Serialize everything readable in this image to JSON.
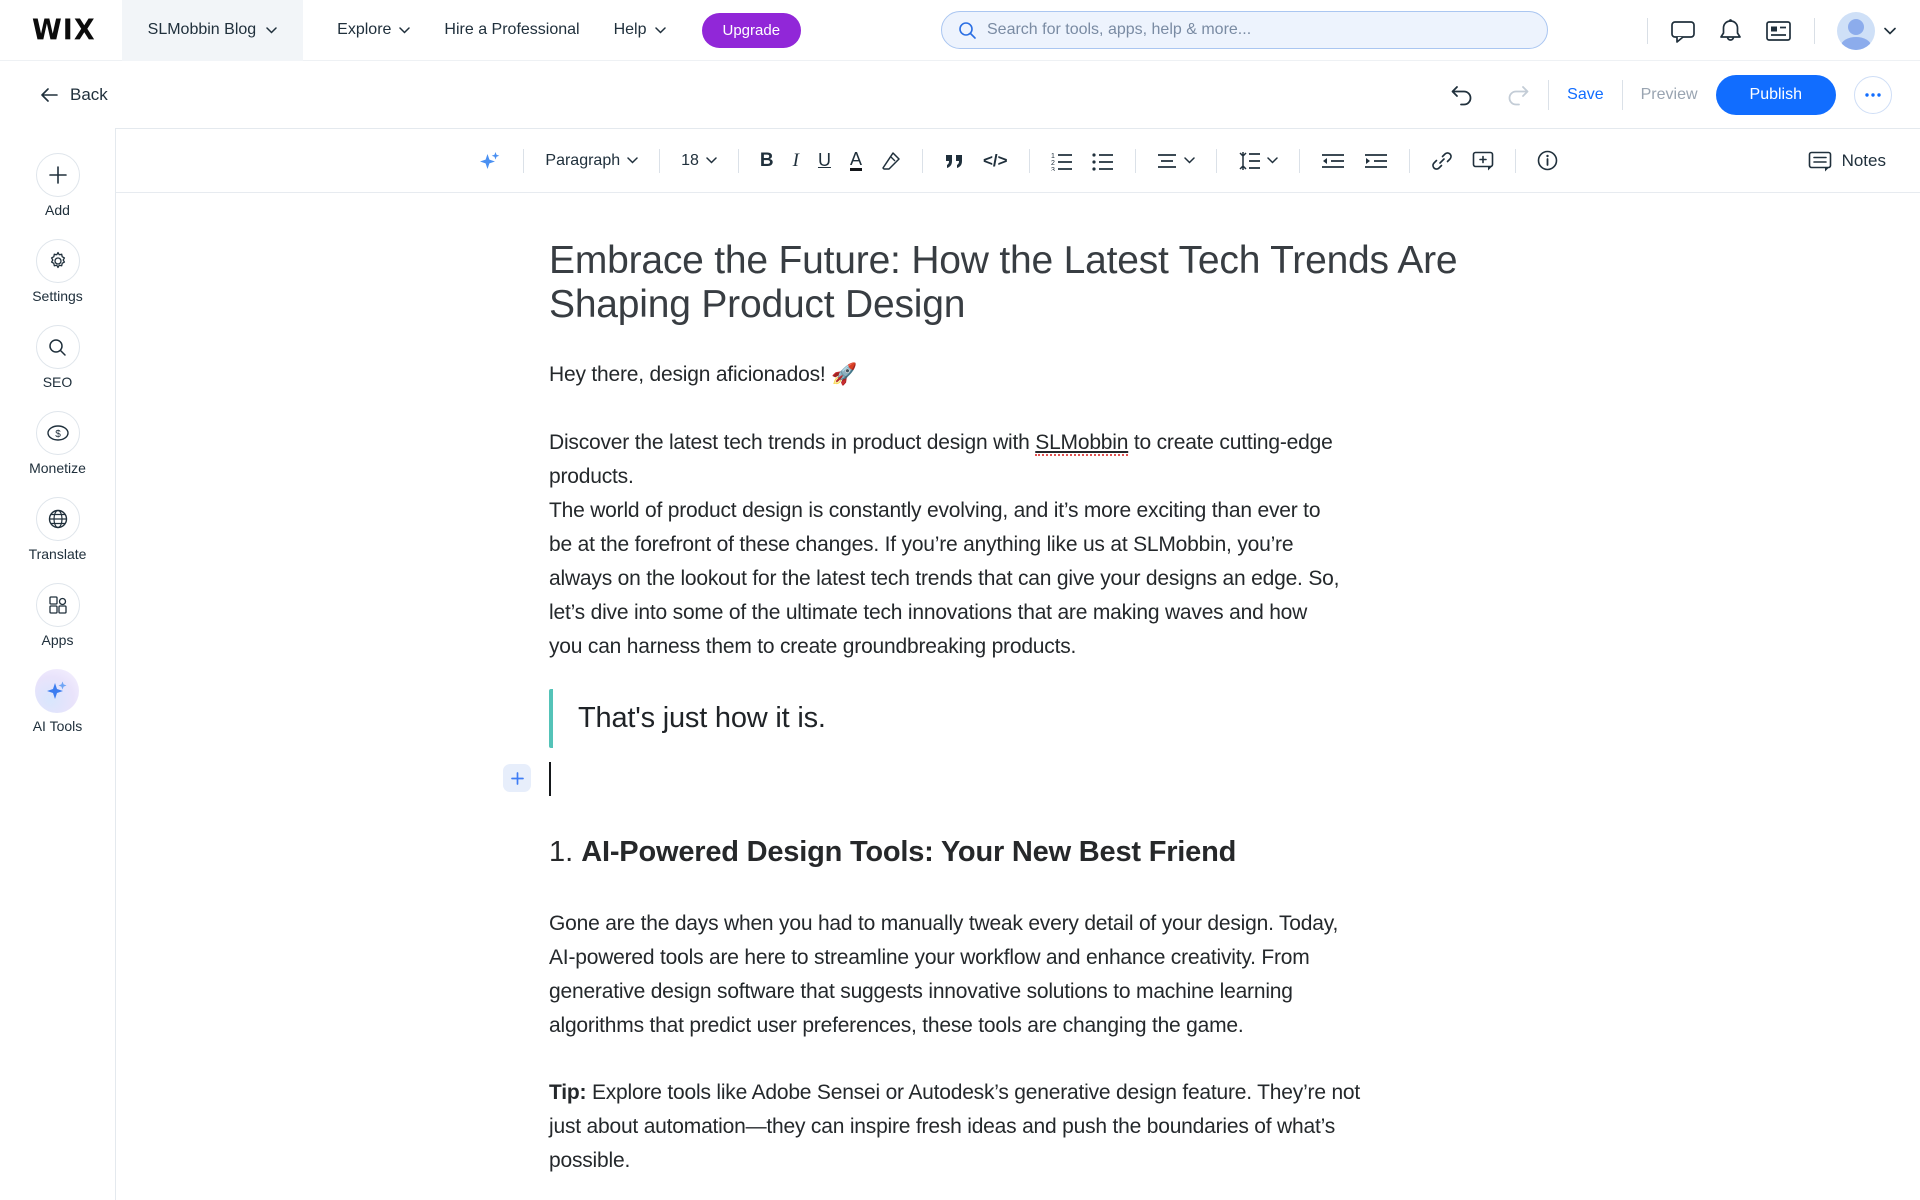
{
  "header": {
    "logo": "WIX",
    "site_menu_label": "SLMobbin Blog",
    "nav": [
      {
        "label": "Explore"
      },
      {
        "label": "Hire a Professional"
      },
      {
        "label": "Help"
      }
    ],
    "upgrade_label": "Upgrade",
    "search_placeholder": "Search for tools, apps, help & more..."
  },
  "editbar": {
    "back_label": "Back",
    "save_label": "Save",
    "preview_label": "Preview",
    "publish_label": "Publish",
    "more_label": "•••"
  },
  "sidebar": {
    "items": [
      {
        "icon": "plus-icon",
        "label": "Add"
      },
      {
        "icon": "gear-icon",
        "label": "Settings"
      },
      {
        "icon": "search-icon",
        "label": "SEO"
      },
      {
        "icon": "dollar-icon",
        "label": "Monetize"
      },
      {
        "icon": "globe-icon",
        "label": "Translate"
      },
      {
        "icon": "apps-grid-icon",
        "label": "Apps"
      },
      {
        "icon": "ai-sparkle-icon",
        "label": "AI Tools"
      }
    ]
  },
  "toolbar": {
    "style_dropdown": "Paragraph",
    "font_size": "18",
    "bold_label": "B",
    "italic_label": "I",
    "underline_label": "U",
    "text_color_label": "A",
    "code_label": "</>",
    "notes_label": "Notes"
  },
  "editor": {
    "title": "Embrace the Future: How the Latest Tech Trends Are\nShaping Product Design",
    "intro": "Hey there, design aficionados! 🚀",
    "para1_pre": "Discover the latest tech trends in product design with ",
    "para1_brand": "SLMobbin",
    "para1_post": " to create cutting-edge\nproducts.\nThe world of product design is constantly evolving, and it’s more exciting than ever to\nbe at the forefront of these changes. If you’re anything like us at SLMobbin, you’re\nalways on the lookout for the latest tech trends that can give your designs an edge. So,\nlet’s dive into some of the ultimate tech innovations that are making waves and how\nyou can harness them to create groundbreaking products.",
    "quote": "That's just how it is.",
    "heading_number": "1. ",
    "heading_text": "AI-Powered Design Tools: Your New Best Friend",
    "para2": "Gone are the days when you had to manually tweak every detail of your design. Today,\nAI-powered tools are here to streamline your workflow and enhance creativity. From\ngenerative design software that suggests innovative solutions to machine learning\nalgorithms that predict user preferences, these tools are changing the game.",
    "tip_label": "Tip:",
    "tip_text": " Explore tools like Adobe Sensei or Autodesk’s generative design feature. They’re not\njust about automation—they can inspire fresh ideas and push the boundaries of what’s\npossible."
  },
  "colors": {
    "accent_blue": "#116dff",
    "upgrade_purple": "#9127d8",
    "quote_teal": "#54c3b8",
    "spellcheck_red": "#e05252"
  }
}
